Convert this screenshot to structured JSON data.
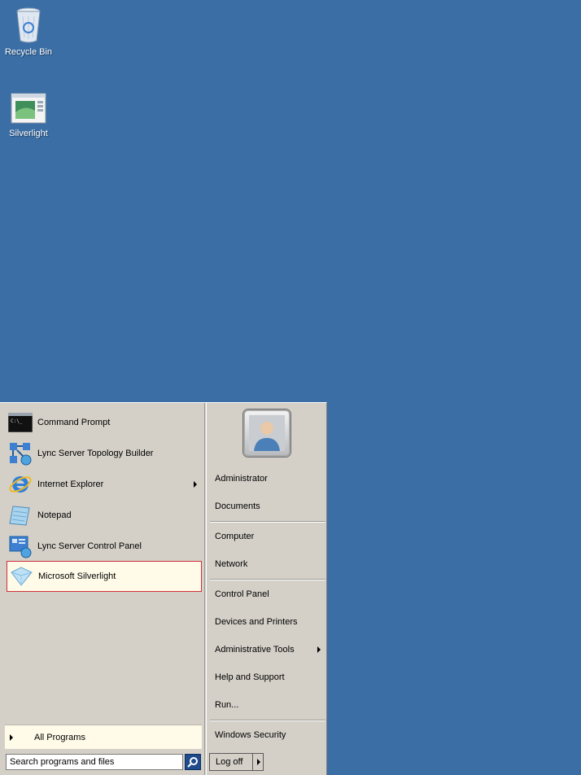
{
  "desktop": {
    "icons": [
      {
        "label": "Recycle Bin",
        "icon": "recycle-bin-icon"
      },
      {
        "label": "Silverlight",
        "icon": "silverlight-app-icon"
      }
    ]
  },
  "start_menu": {
    "programs": [
      {
        "label": "Command Prompt",
        "icon": "command-prompt-icon",
        "has_submenu": false,
        "selected": false
      },
      {
        "label": "Lync Server Topology Builder",
        "icon": "topology-builder-icon",
        "has_submenu": false,
        "selected": false
      },
      {
        "label": "Internet Explorer",
        "icon": "internet-explorer-icon",
        "has_submenu": true,
        "selected": false
      },
      {
        "label": "Notepad",
        "icon": "notepad-icon",
        "has_submenu": false,
        "selected": false
      },
      {
        "label": "Lync Server Control Panel",
        "icon": "lync-control-panel-icon",
        "has_submenu": false,
        "selected": false
      },
      {
        "label": "Microsoft Silverlight",
        "icon": "silverlight-icon",
        "has_submenu": false,
        "selected": true
      }
    ],
    "all_programs_label": "All Programs",
    "search": {
      "placeholder": "Search programs and files",
      "value": ""
    },
    "right_items": [
      {
        "label": "Administrator",
        "has_submenu": false
      },
      {
        "label": "Documents",
        "has_submenu": false
      },
      {
        "label": "Computer",
        "has_submenu": false
      },
      {
        "label": "Network",
        "has_submenu": false
      },
      {
        "label": "Control Panel",
        "has_submenu": false
      },
      {
        "label": "Devices and Printers",
        "has_submenu": false
      },
      {
        "label": "Administrative Tools",
        "has_submenu": true
      },
      {
        "label": "Help and Support",
        "has_submenu": false
      },
      {
        "label": "Run...",
        "has_submenu": false
      },
      {
        "label": "Windows Security",
        "has_submenu": false
      }
    ],
    "logoff_label": "Log off"
  },
  "colors": {
    "desktop": "#3a6ea5",
    "menu_bg": "#d4d0c8",
    "selected_bg": "#fffbe8",
    "selected_border": "#d0303a"
  }
}
